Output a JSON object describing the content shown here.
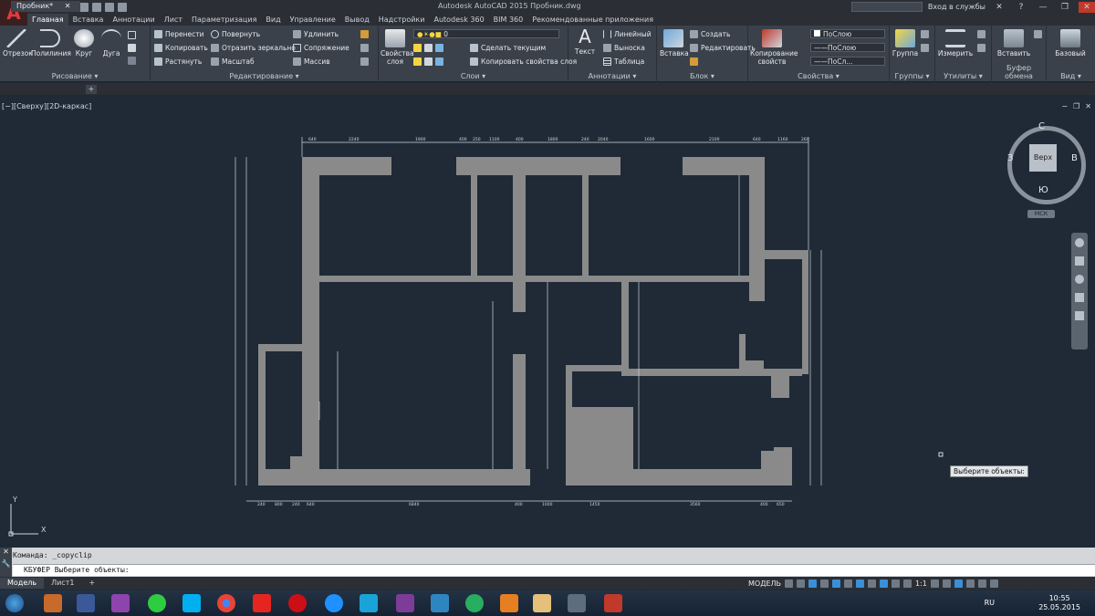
{
  "app": {
    "title": "Autodesk AutoCAD 2015   Пробник.dwg",
    "signin_label": "Вход в службы",
    "logo_letter": "A"
  },
  "tabs": [
    "Главная",
    "Вставка",
    "Аннотации",
    "Лист",
    "Параметризация",
    "Вид",
    "Управление",
    "Вывод",
    "Надстройки",
    "Autodesk 360",
    "BIM 360",
    "Рекомендованные приложения"
  ],
  "ribbon": {
    "draw": {
      "label": "Рисование ▾",
      "line": "Отрезок",
      "polyline": "Полилиния",
      "circle": "Круг",
      "arc": "Дуга"
    },
    "modify": {
      "label": "Редактирование ▾",
      "move": "Перенести",
      "rotate": "Повернуть",
      "trim": "Удлинить",
      "copy": "Копировать",
      "mirror": "Отразить зеркально",
      "fillet": "Сопряжение",
      "stretch": "Растянуть",
      "scale": "Масштаб",
      "array": "Массив"
    },
    "layers": {
      "label": "Слои ▾",
      "properties": "Свойства слоя",
      "layer_value": "0",
      "make_current": "Сделать текущим",
      "match_layer": "Копировать свойства слоя"
    },
    "annotation": {
      "label": "Аннотации ▾",
      "text": "Текст",
      "linear": "Линейный",
      "leader": "Выноска",
      "table": "Таблица"
    },
    "block": {
      "label": "Блок ▾",
      "insert": "Вставка",
      "create": "Создать",
      "edit": "Редактировать"
    },
    "properties": {
      "label": "Свойства ▾",
      "match": "Копирование свойств",
      "color": "ПоСлою",
      "linetype": "ПоСлою",
      "lineweight": "ПоСл..."
    },
    "groups": {
      "label": "Группы ▾",
      "group": "Группа"
    },
    "utilities": {
      "label": "Утилиты ▾",
      "measure": "Измерить"
    },
    "clipboard": {
      "label": "Буфер обмена",
      "paste": "Вставить"
    },
    "view": {
      "label": "Вид ▾",
      "base": "Базовый"
    }
  },
  "document": {
    "tab_label": "Пробник*",
    "view_label": "[−][Сверху][2D-каркас]"
  },
  "viewcube": {
    "north": "С",
    "south": "Ю",
    "east": "В",
    "west": "З",
    "face": "Верх",
    "ucs": "МСК"
  },
  "dimensions": {
    "top": [
      "640",
      "2240",
      "1900",
      "400",
      "250",
      "1100",
      "400",
      "1800",
      "240",
      "2040",
      "1600",
      "2100",
      "640",
      "1160",
      "260"
    ],
    "bottom": [
      "240",
      "800",
      "240",
      "640",
      "6840",
      "400",
      "1000",
      "1450",
      "3560",
      "400",
      "650"
    ]
  },
  "axes": {
    "x": "X",
    "y": "Y"
  },
  "tooltip": "Выберите объекты:",
  "command": {
    "history": "Команда: _copyclip",
    "prompt": "КБУФЕР Выберите объекты:"
  },
  "layout_tabs": [
    "Модель",
    "Лист1"
  ],
  "statusbar": {
    "mode": "МОДЕЛЬ",
    "scale": "1:1"
  },
  "taskbar": {
    "lang": "RU",
    "time": "10:55",
    "date": "25.05.2015"
  },
  "colors": {
    "accent": "#c8102e",
    "background": "#1f2a36",
    "wall": "#8a8a8a"
  }
}
